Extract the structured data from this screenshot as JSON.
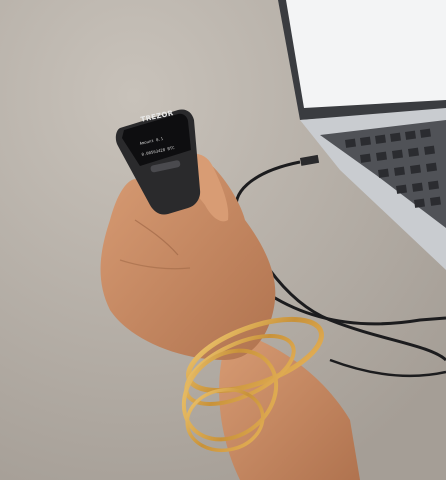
{
  "device": {
    "brand": "TREZOR",
    "screen_line_1": "Amount 0.1",
    "screen_line_2": "0.00563428 BTC",
    "button_label": "CONFIRM"
  },
  "colors": {
    "floor": "#b8b2aa",
    "laptop_body": "#c9ccd0",
    "laptop_screen": "#f2f3f4",
    "skin": "#c98d67",
    "gold": "#d4a24a",
    "device": "#2a2a2c"
  }
}
